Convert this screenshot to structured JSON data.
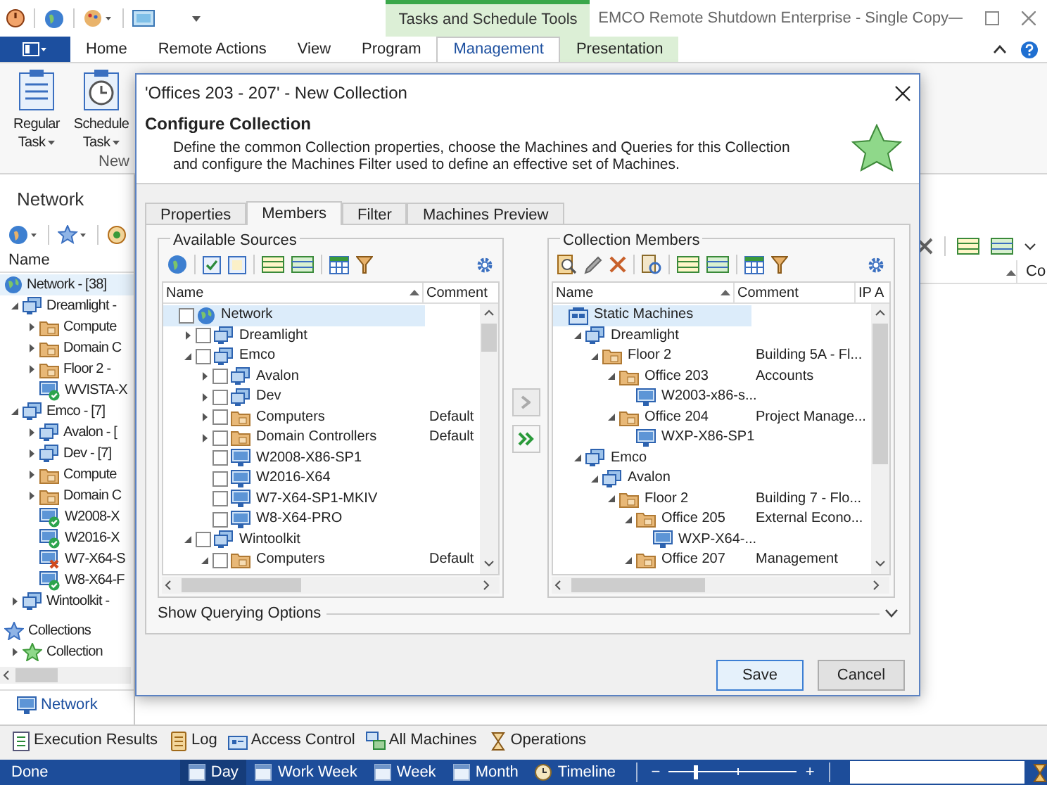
{
  "title_bar": {
    "contextual_group": "Tasks and Schedule Tools",
    "app_title": "EMCO Remote Shutdown Enterprise - Single Copy"
  },
  "ribbon": {
    "tabs": [
      {
        "label": "Home",
        "selected": false,
        "kind": "normal"
      },
      {
        "label": "Remote Actions",
        "selected": false,
        "kind": "normal"
      },
      {
        "label": "View",
        "selected": false,
        "kind": "normal"
      },
      {
        "label": "Program",
        "selected": false,
        "kind": "normal"
      },
      {
        "label": "Management",
        "selected": true,
        "kind": "contextual"
      },
      {
        "label": "Presentation",
        "selected": false,
        "kind": "contextual"
      }
    ],
    "buttons": [
      {
        "lines": [
          "Regular",
          "Task"
        ],
        "kind": "regular"
      },
      {
        "lines": [
          "Schedule",
          "Task"
        ],
        "kind": "schedule"
      }
    ],
    "group_label": "New"
  },
  "network_panel": {
    "title": "Network",
    "column": "Name",
    "tree": [
      {
        "label": "Network - [38]",
        "kind": "globe",
        "selected": true,
        "children": [
          {
            "label": "Dreamlight -",
            "kind": "domain",
            "selected": false,
            "expanded": true,
            "children": [
              {
                "label": "Compute",
                "kind": "folder",
                "selected": false,
                "expanded": false
              },
              {
                "label": "Domain C",
                "kind": "folder",
                "selected": false,
                "expanded": false
              },
              {
                "label": "Floor 2 -",
                "kind": "folder",
                "selected": false,
                "expanded": false
              },
              {
                "label": "WVISTA-X",
                "kind": "machine-ok",
                "selected": false
              }
            ]
          },
          {
            "label": "Emco - [7]",
            "kind": "domain",
            "selected": false,
            "expanded": true,
            "children": [
              {
                "label": "Avalon - [",
                "kind": "domain",
                "selected": false,
                "expanded": false
              },
              {
                "label": "Dev - [7]",
                "kind": "domain",
                "selected": false,
                "expanded": false
              },
              {
                "label": "Compute",
                "kind": "folder",
                "selected": false,
                "expanded": false
              },
              {
                "label": "Domain C",
                "kind": "folder",
                "selected": false,
                "expanded": false
              },
              {
                "label": "W2008-X",
                "kind": "machine-ok",
                "selected": false
              },
              {
                "label": "W2016-X",
                "kind": "machine-ok",
                "selected": false
              },
              {
                "label": "W7-X64-S",
                "kind": "machine-error",
                "selected": false
              },
              {
                "label": "W8-X64-F",
                "kind": "machine-ok",
                "selected": false
              }
            ]
          },
          {
            "label": "Wintoolkit -",
            "kind": "domain",
            "selected": false,
            "expanded": false
          }
        ]
      }
    ],
    "collections": [
      {
        "label": "Collections",
        "kind": "star-blue",
        "selected": false,
        "children": [
          {
            "label": "Collection",
            "kind": "star-green",
            "selected": false,
            "expanded": false
          }
        ]
      }
    ],
    "nav_button": "Network"
  },
  "main_view": {
    "column_2": "Co"
  },
  "bottom_tabs": [
    {
      "label": "Execution Results",
      "kind": "results"
    },
    {
      "label": "Log",
      "kind": "log"
    },
    {
      "label": "Access Control",
      "kind": "access"
    },
    {
      "label": "All Machines",
      "kind": "machines"
    },
    {
      "label": "Operations",
      "kind": "operations"
    }
  ],
  "status_bar": {
    "text": "Done",
    "views": [
      {
        "label": "Day",
        "kind": "calendar",
        "selected": true
      },
      {
        "label": "Work Week",
        "kind": "calendar",
        "selected": false
      },
      {
        "label": "Week",
        "kind": "calendar",
        "selected": false
      },
      {
        "label": "Month",
        "kind": "calendar",
        "selected": false
      },
      {
        "label": "Timeline",
        "kind": "clock",
        "selected": false
      }
    ],
    "zoom": {
      "minus": "−",
      "plus": "+",
      "level": 0.18
    }
  },
  "dialog": {
    "title": "'Offices 203 - 207' - New Collection",
    "heading": "Configure Collection",
    "description": "Define the common Collection properties, choose the Machines and Queries for this Collection and configure the Machines Filter used to define an effective set of Machines.",
    "tabs": [
      {
        "label": "Properties",
        "selected": false
      },
      {
        "label": "Members",
        "selected": true
      },
      {
        "label": "Filter",
        "selected": false
      },
      {
        "label": "Machines Preview",
        "selected": false
      }
    ],
    "sources": {
      "title": "Available Sources",
      "columns": [
        "Name",
        "Comment"
      ],
      "tree": [
        {
          "label": "Network",
          "kind": "globe",
          "checked": false,
          "selected": true,
          "children": [
            {
              "label": "Dreamlight",
              "kind": "domain",
              "checked": false,
              "selected": false,
              "expanded": false
            },
            {
              "label": "Emco",
              "kind": "domain",
              "checked": false,
              "selected": false,
              "expanded": true,
              "children": [
                {
                  "label": "Avalon",
                  "kind": "domain",
                  "checked": false,
                  "selected": false,
                  "expanded": false
                },
                {
                  "label": "Dev",
                  "kind": "domain",
                  "checked": false,
                  "selected": false,
                  "expanded": false
                },
                {
                  "label": "Computers",
                  "comment": "Default",
                  "kind": "folder",
                  "checked": false,
                  "selected": false,
                  "expanded": false
                },
                {
                  "label": "Domain Controllers",
                  "comment": "Default",
                  "kind": "folder",
                  "checked": false,
                  "selected": false,
                  "expanded": false
                },
                {
                  "label": "W2008-X86-SP1",
                  "kind": "machine",
                  "checked": false,
                  "selected": false
                },
                {
                  "label": "W2016-X64",
                  "kind": "machine",
                  "checked": false,
                  "selected": false
                },
                {
                  "label": "W7-X64-SP1-MKIV",
                  "kind": "machine",
                  "checked": false,
                  "selected": false
                },
                {
                  "label": "W8-X64-PRO",
                  "kind": "machine",
                  "checked": false,
                  "selected": false
                }
              ]
            },
            {
              "label": "Wintoolkit",
              "kind": "domain",
              "checked": false,
              "selected": false,
              "expanded": true,
              "children": [
                {
                  "label": "Computers",
                  "comment": "Default",
                  "kind": "folder",
                  "checked": false,
                  "selected": false,
                  "expanded": true
                }
              ]
            }
          ]
        }
      ]
    },
    "members": {
      "title": "Collection Members",
      "columns": [
        "Name",
        "Comment",
        "IP A"
      ],
      "tree": [
        {
          "label": "Static Machines",
          "kind": "static",
          "selected": true,
          "children": [
            {
              "label": "Dreamlight",
              "kind": "domain",
              "selected": false,
              "expanded": true,
              "children": [
                {
                  "label": "Floor 2",
                  "comment": "Building 5A - Fl...",
                  "kind": "folder",
                  "selected": false,
                  "expanded": true,
                  "children": [
                    {
                      "label": "Office 203",
                      "comment": "Accounts",
                      "kind": "folder",
                      "selected": false,
                      "expanded": true,
                      "children": [
                        {
                          "label": "W2003-x86-s...",
                          "kind": "machine",
                          "selected": false
                        }
                      ]
                    },
                    {
                      "label": "Office 204",
                      "comment": "Project Manage...",
                      "kind": "folder",
                      "selected": false,
                      "expanded": true,
                      "children": [
                        {
                          "label": "WXP-X86-SP1",
                          "kind": "machine",
                          "selected": false
                        }
                      ]
                    }
                  ]
                }
              ]
            },
            {
              "label": "Emco",
              "kind": "domain",
              "selected": false,
              "expanded": true,
              "children": [
                {
                  "label": "Avalon",
                  "kind": "domain",
                  "selected": false,
                  "expanded": true,
                  "children": [
                    {
                      "label": "Floor 2",
                      "comment": "Building 7 - Flo...",
                      "kind": "folder",
                      "selected": false,
                      "expanded": true,
                      "children": [
                        {
                          "label": "Office 205",
                          "comment": "External Econo...",
                          "kind": "folder",
                          "selected": false,
                          "expanded": true,
                          "children": [
                            {
                              "label": "WXP-X64-...",
                              "kind": "machine",
                              "selected": false
                            }
                          ]
                        },
                        {
                          "label": "Office 207",
                          "comment": "Management",
                          "kind": "folder",
                          "selected": false,
                          "expanded": true
                        }
                      ]
                    }
                  ]
                }
              ]
            }
          ]
        }
      ]
    },
    "querying_options": "Show Querying Options",
    "buttons": [
      {
        "label": "Save",
        "kind": "default"
      },
      {
        "label": "Cancel",
        "kind": "normal"
      }
    ]
  }
}
